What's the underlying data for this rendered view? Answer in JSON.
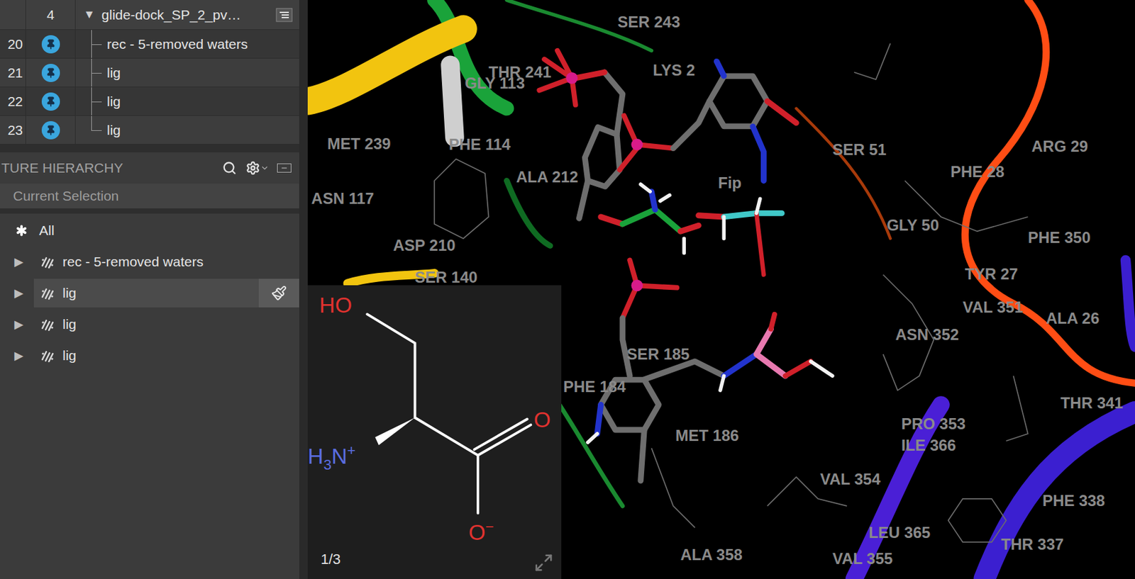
{
  "project_table": {
    "group": {
      "index": "4",
      "expander": "▼",
      "title": "glide-dock_SP_2_pv…",
      "expanded": true
    },
    "rows": [
      {
        "index": "20",
        "title": "rec - 5-removed waters",
        "pinned": true
      },
      {
        "index": "21",
        "title": "lig",
        "pinned": true
      },
      {
        "index": "22",
        "title": "lig",
        "pinned": true
      },
      {
        "index": "23",
        "title": "lig",
        "pinned": true
      }
    ]
  },
  "hierarchy": {
    "title": "TURE HIERARCHY",
    "selection_placeholder": "Current Selection",
    "items": [
      {
        "label": "All",
        "kind": "root",
        "expander": "",
        "expanded": false,
        "selected": false
      },
      {
        "label": "rec - 5-removed waters",
        "kind": "entry",
        "expander": "▶",
        "expanded": false,
        "selected": false
      },
      {
        "label": "lig",
        "kind": "entry",
        "expander": "▶",
        "expanded": false,
        "selected": true
      },
      {
        "label": "lig",
        "kind": "entry",
        "expander": "▶",
        "expanded": false,
        "selected": false
      },
      {
        "label": "lig",
        "kind": "entry",
        "expander": "▶",
        "expanded": false,
        "selected": false
      }
    ]
  },
  "viewer": {
    "residue_labels": [
      "SER 243",
      "THR 241",
      "GLY 113",
      "LYS 2",
      "MET 239",
      "PHE 114",
      "ALA 212",
      "ASN 117",
      "ASP 210",
      "SER 140",
      "Fip",
      "SER 51",
      "ARG 29",
      "PHE 28",
      "GLY 50",
      "PHE 350",
      "TYR 27",
      "VAL 351",
      "ALA 26",
      "ASN 352",
      "SER 185",
      "PHE 184",
      "THR 341",
      "PRO 353",
      "MET 186",
      "ILE 366",
      "VAL 354",
      "PHE 338",
      "LEU 365",
      "THR 337",
      "ALA 358",
      "VAL 355"
    ]
  },
  "inset": {
    "hydroxyl": "HO",
    "amine": {
      "h": "H",
      "count": "3",
      "n": "N",
      "charge": "+"
    },
    "carbonyl": "O",
    "carboxylate": {
      "o": "O",
      "charge": "−"
    },
    "counter": "1/3"
  }
}
